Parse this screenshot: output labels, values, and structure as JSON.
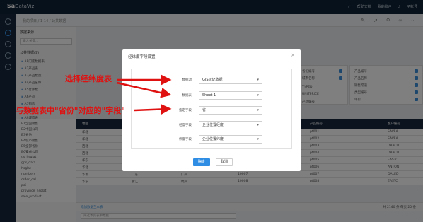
{
  "app": {
    "logo_bold": "Sa",
    "logo_light": "DataViz"
  },
  "topbar": {
    "help": "帮助文档",
    "account": "我的账户",
    "user": "子帐号"
  },
  "breadcrumb": {
    "text": "我的项目  /  1-14  /  公共数据"
  },
  "left_panel": {
    "title": "数据来源",
    "search_placeholder": "输入关键...",
    "section": "公共数据(9)",
    "datasets": [
      "AE门店数据表",
      "A2产品表",
      "A3产品数量",
      "A4产品名称",
      "A5仓库数",
      "A6产品",
      "A7销售",
      "A8城市",
      "A9城市表"
    ]
  },
  "left_grid_items": [
    "B1全国销售",
    "B2中国公司",
    "B3省份",
    "B4城市销售",
    "B5全部省份",
    "B6安卓公司",
    "ds_hsglat",
    "gps_data",
    "hsglat",
    "numbers",
    "order_cal",
    "poi",
    "province_hsglat",
    "sale_product"
  ],
  "mid_panel": {
    "items": [
      "省份编号",
      "城市名称",
      "TYPED",
      "UNITPRICE",
      "产品编号"
    ]
  },
  "right_panel": {
    "title": "A2产品表",
    "items": [
      "产品编号",
      "产品名称",
      "销售渠道",
      "类型编号",
      "单价"
    ]
  },
  "grid": {
    "headers": [
      "地区",
      "省份",
      "城市",
      "订单号",
      "产品编号",
      "客户编号"
    ],
    "rows": [
      [
        "华北",
        "北京",
        "北京",
        "10001",
        "pt001",
        "SAVEA"
      ],
      [
        "华北",
        "北京",
        "北京",
        "10002",
        "pt002",
        "SAVEA"
      ],
      [
        "西北",
        "陕西",
        "西安",
        "10003",
        "pt003",
        "DRACD"
      ],
      [
        "西北",
        "陕西",
        "西安",
        "10004",
        "pt004",
        "DRACD"
      ],
      [
        "华东",
        "江苏",
        "南京",
        "10005",
        "pt005",
        "EASTC"
      ],
      [
        "华北",
        "河北",
        "石家庄",
        "10006",
        "pt006",
        "ANTON"
      ],
      [
        "华南",
        "广东",
        "广州",
        "10007",
        "pt007",
        "QALED"
      ],
      [
        "华东",
        "浙江",
        "杭州",
        "10008",
        "pt008",
        "EASTC"
      ]
    ]
  },
  "pager": {
    "left": "添加数据至本表",
    "total": "共 2140 条",
    "per_page_label": "每页",
    "per_page": "20",
    "unit": "条"
  },
  "filter": {
    "placeholder": "筛选本页表中数据"
  },
  "modal": {
    "title": "经纬度字段设置",
    "fields": [
      {
        "label": "数据源",
        "value": "GIS标记数据"
      },
      {
        "label": "数据表",
        "value": "Sheet 1"
      },
      {
        "label": "指定字段",
        "value": "省"
      },
      {
        "label": "经度字段",
        "value": "企业位置经度"
      },
      {
        "label": "纬度字段",
        "value": "企业位置纬度"
      }
    ],
    "ok": "确定",
    "cancel": "取消"
  },
  "annotations": {
    "choose_table": "选择经纬度表",
    "match_field": "与数据表中\"省份\"对应的\"字段\""
  },
  "colors": {
    "annotation": "#e01111",
    "primary": "#2f8de4",
    "topbar": "#0f2236"
  }
}
